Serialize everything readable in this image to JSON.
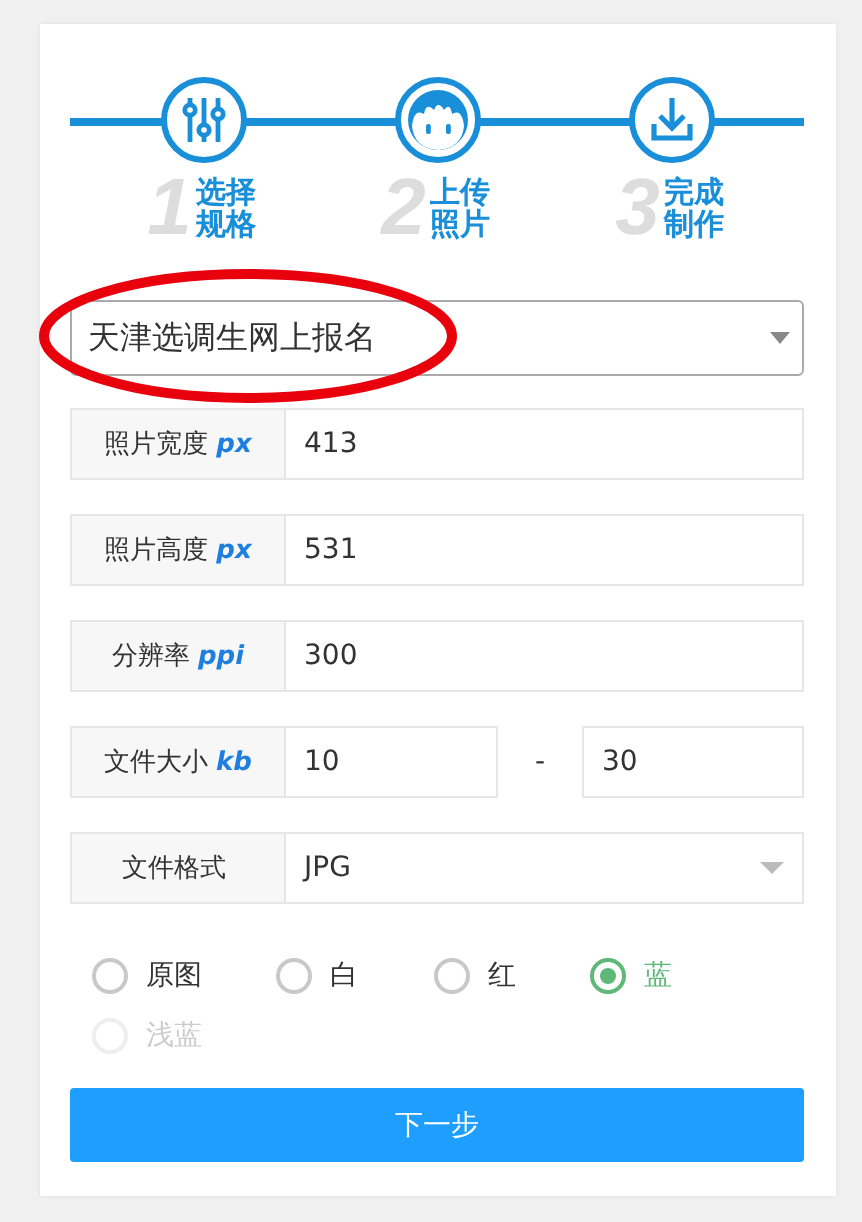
{
  "steps": [
    {
      "number": "1",
      "label": "选择规格"
    },
    {
      "number": "2",
      "label": "上传照片"
    },
    {
      "number": "3",
      "label": "完成制作"
    }
  ],
  "preset": {
    "value": "天津选调生网上报名",
    "highlighted": true
  },
  "fields": [
    {
      "kind": "input",
      "label": "照片宽度",
      "unit": "px",
      "value": "413"
    },
    {
      "kind": "input",
      "label": "照片高度",
      "unit": "px",
      "value": "531"
    },
    {
      "kind": "input",
      "label": "分辨率",
      "unit": "ppi",
      "value": "300"
    },
    {
      "kind": "range",
      "label": "文件大小",
      "unit": "kb",
      "values": [
        "10",
        "30"
      ],
      "separator": "-"
    },
    {
      "kind": "select",
      "label": "文件格式",
      "value": "JPG"
    }
  ],
  "background_colors": [
    {
      "label": "原图",
      "selected": false,
      "disabled": false
    },
    {
      "label": "白",
      "selected": false,
      "disabled": false
    },
    {
      "label": "红",
      "selected": false,
      "disabled": false
    },
    {
      "label": "蓝",
      "selected": true,
      "disabled": false
    },
    {
      "label": "浅蓝",
      "selected": false,
      "disabled": true
    }
  ],
  "next_button": "下一步"
}
